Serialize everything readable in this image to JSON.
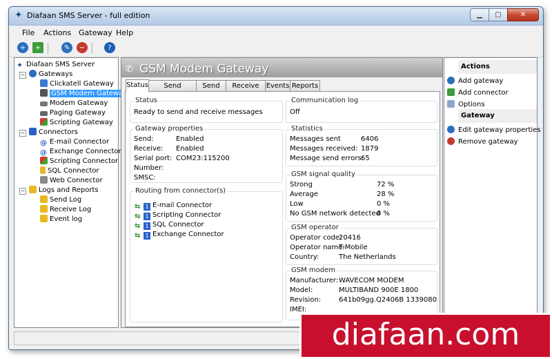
{
  "window": {
    "title": "Diafaan SMS Server - full edition"
  },
  "menu": [
    "File",
    "Actions",
    "Gateway",
    "Help"
  ],
  "tree": {
    "root": "Diafaan SMS Server",
    "gateways_label": "Gateways",
    "gateways": [
      "Clickatell Gateway",
      "GSM Modem Gateway",
      "Modem Gateway",
      "Paging Gateway",
      "Scripting Gateway"
    ],
    "connectors_label": "Connectors",
    "connectors": [
      "E-mail Connector",
      "Exchange Connector",
      "Scripting Connector",
      "SQL Connector",
      "Web Connector"
    ],
    "logs_label": "Logs and Reports",
    "logs": [
      "Send Log",
      "Receive Log",
      "Event log"
    ]
  },
  "center": {
    "title": "GSM Modem Gateway",
    "tabs": [
      "Status",
      "Send Message",
      "Send log",
      "Receive log",
      "Events",
      "Reports"
    ],
    "status": {
      "label": "Status",
      "value": "Ready to send and receive messages"
    },
    "gateway_properties": {
      "label": "Gateway properties",
      "rows": [
        {
          "k": "Send:",
          "v": "Enabled"
        },
        {
          "k": "Receive:",
          "v": "Enabled"
        },
        {
          "k": "Serial port:",
          "v": "COM23:115200"
        },
        {
          "k": "Number:",
          "v": ""
        },
        {
          "k": "SMSC:",
          "v": ""
        }
      ]
    },
    "routing": {
      "label": "Routing from connector(s)",
      "badge": "1",
      "items": [
        "E-mail Connector",
        "Scripting Connector",
        "SQL Connector",
        "Exchange Connector"
      ]
    },
    "comm_log": {
      "label": "Communication log",
      "value": "Off"
    },
    "statistics": {
      "label": "Statistics",
      "rows": [
        {
          "k": "Messages sent",
          "v": "6406"
        },
        {
          "k": "Messages received:",
          "v": "1879"
        },
        {
          "k": "Message send errors:",
          "v": "65"
        }
      ]
    },
    "signal": {
      "label": "GSM signal quality",
      "rows": [
        {
          "k": "Strong",
          "v": "72 %"
        },
        {
          "k": "Average",
          "v": "28 %"
        },
        {
          "k": "Low",
          "v": "0 %"
        },
        {
          "k": "No GSM network detected",
          "v": "0 %"
        }
      ]
    },
    "operator": {
      "label": "GSM operator",
      "rows": [
        {
          "k": "Operator code:",
          "v": "20416"
        },
        {
          "k": "Operator name:",
          "v": "T-Mobile"
        },
        {
          "k": "Country:",
          "v": "The Netherlands"
        }
      ]
    },
    "modem": {
      "label": "GSM modem",
      "rows": [
        {
          "k": "Manufacturer:",
          "v": "WAVECOM MODEM"
        },
        {
          "k": "Model:",
          "v": "MULTIBAND  900E  1800"
        },
        {
          "k": "Revision:",
          "v": "641b09gg.Q2406B 1339080"
        },
        {
          "k": "IMEI:",
          "v": ""
        }
      ]
    }
  },
  "actions": {
    "header": "Actions",
    "items": [
      "Add gateway",
      "Add connector",
      "Options"
    ],
    "gateway_header": "Gateway",
    "gateway_items": [
      "Edit gateway properties",
      "Remove gateway"
    ]
  },
  "brand": "diafaan.com",
  "colors": {
    "selection": "#3399ff",
    "brand": "#c8102e",
    "close": "#c74a32"
  }
}
